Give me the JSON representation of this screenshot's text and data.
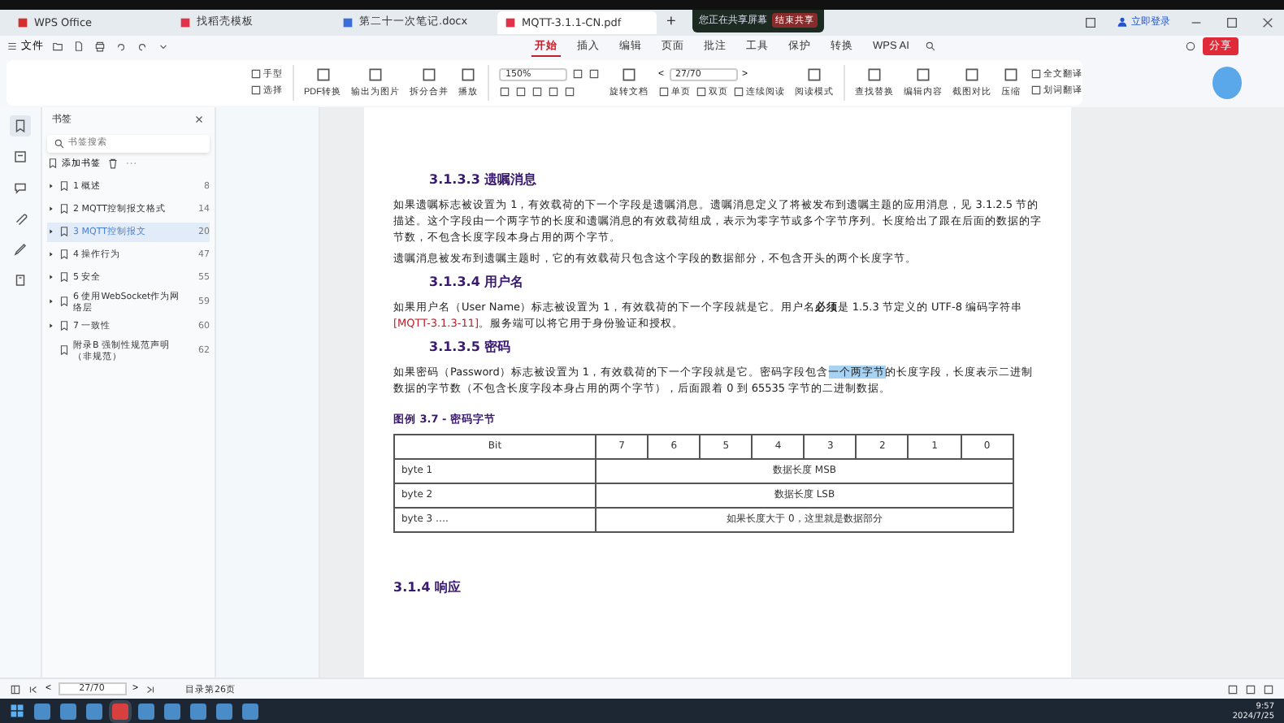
{
  "share_banner": {
    "text": "您正在共享屏幕",
    "button": "结束共享"
  },
  "tabs": [
    {
      "label": "WPS Office",
      "kind": "home",
      "selected": false
    },
    {
      "label": "找稻壳模板",
      "kind": "pdf",
      "selected": false
    },
    {
      "label": "第二十一次笔记.docx",
      "kind": "doc",
      "selected": false
    },
    {
      "label": "MQTT-3.1.1-CN.pdf",
      "kind": "pdf",
      "selected": true
    }
  ],
  "new_tab": "+",
  "account": {
    "label": "立即登录"
  },
  "menu": {
    "file": "文件",
    "items": [
      {
        "label": "开始",
        "selected": true
      },
      {
        "label": "插入",
        "selected": false
      },
      {
        "label": "编辑",
        "selected": false
      },
      {
        "label": "页面",
        "selected": false
      },
      {
        "label": "批注",
        "selected": false
      },
      {
        "label": "工具",
        "selected": false
      },
      {
        "label": "保护",
        "selected": false
      },
      {
        "label": "转换",
        "selected": false
      }
    ],
    "ai": "WPS AI",
    "share": "分享"
  },
  "toolbar": [
    [
      [
        {
          "kind": "small",
          "label": "手型"
        }
      ],
      [
        {
          "kind": "small",
          "label": "选择"
        }
      ]
    ],
    [
      [
        {
          "kind": "large",
          "label": "PDF转换"
        }
      ]
    ],
    [
      [
        {
          "kind": "large",
          "label": "输出为图片"
        }
      ]
    ],
    [
      [
        {
          "kind": "large",
          "label": "拆分合并"
        }
      ]
    ],
    [
      [
        {
          "kind": "large",
          "label": "播放"
        }
      ]
    ],
    [
      [
        {
          "kind": "field",
          "label": "150%"
        },
        {
          "kind": "icon"
        },
        {
          "kind": "icon"
        }
      ],
      [
        {
          "kind": "icon"
        },
        {
          "kind": "icon"
        },
        {
          "kind": "icon"
        },
        {
          "kind": "icon"
        },
        {
          "kind": "icon"
        }
      ]
    ],
    [
      [
        {
          "kind": "large",
          "label": "旋转文档"
        }
      ]
    ],
    [
      [
        {
          "kind": "nav",
          "label": "<"
        },
        {
          "kind": "field",
          "label": "27/70"
        },
        {
          "kind": "nav",
          "label": ">"
        }
      ],
      [
        {
          "kind": "small",
          "label": "单页"
        },
        {
          "kind": "small",
          "label": "双页"
        },
        {
          "kind": "small",
          "label": "连续阅读"
        }
      ]
    ],
    [
      [
        {
          "kind": "large",
          "label": "阅读模式"
        }
      ]
    ],
    [
      [
        {
          "kind": "large",
          "label": "查找替换"
        }
      ]
    ],
    [
      [
        {
          "kind": "large",
          "label": "编辑内容"
        }
      ]
    ],
    [
      [
        {
          "kind": "large",
          "label": "截图对比"
        }
      ]
    ],
    [
      [
        {
          "kind": "large",
          "label": "压缩"
        }
      ]
    ],
    [
      [
        {
          "kind": "small",
          "label": "全文翻译"
        }
      ],
      [
        {
          "kind": "small",
          "label": "划词翻译"
        }
      ]
    ]
  ],
  "side_icons": [
    {
      "selected": true
    },
    {
      "selected": false
    },
    {
      "selected": false
    },
    {
      "selected": false
    },
    {
      "selected": false
    },
    {
      "selected": false
    }
  ],
  "bookmarks": {
    "title": "书签",
    "search": {
      "placeholder": "书签搜索"
    },
    "add": "添加书签",
    "items": [
      {
        "label": "1 概述",
        "page": "8",
        "expandable": true,
        "selected": false
      },
      {
        "label": "2 MQTT控制报文格式",
        "page": "14",
        "expandable": true,
        "selected": false
      },
      {
        "label": "3 MQTT控制报文",
        "page": "20",
        "expandable": true,
        "selected": true
      },
      {
        "label": "4 操作行为",
        "page": "47",
        "expandable": true,
        "selected": false
      },
      {
        "label": "5 安全",
        "page": "55",
        "expandable": true,
        "selected": false
      },
      {
        "label": "6 使用WebSocket作为网络层",
        "page": "59",
        "expandable": true,
        "selected": false
      },
      {
        "label": "7 一致性",
        "page": "60",
        "expandable": true,
        "selected": false
      },
      {
        "label": "附录B 强制性规范声明（非规范）",
        "page": "62",
        "expandable": false,
        "selected": false
      }
    ]
  },
  "document": [
    {
      "kind": "heading",
      "text": "3.1.3.3 遗嘱消息"
    },
    {
      "kind": "para",
      "runs": [
        {
          "kind": "plain",
          "text": "如果遗嘱标志被设置为 1，有效载荷的下一个字段是遗嘱消息。遗嘱消息定义了将被发布到遗嘱主题的应用消息，见 3.1.2.5 节的描述。这个字段由一个两字节的长度和遗嘱消息的有效载荷组成，表示为零字节或多个字节序列。长度给出了跟在后面的数据的字节数，不包含长度字段本身占用的两个字节。"
        }
      ]
    },
    {
      "kind": "para",
      "runs": [
        {
          "kind": "plain",
          "text": "遗嘱消息被发布到遗嘱主题时，它的有效载荷只包含这个字段的数据部分，不包含开头的两个长度字节。"
        }
      ]
    },
    {
      "kind": "heading",
      "text": "3.1.3.4 用户名"
    },
    {
      "kind": "para",
      "runs": [
        {
          "kind": "plain",
          "text": "如果用户名（User Name）标志被设置为 1，有效载荷的下一个字段就是它。用户名"
        },
        {
          "kind": "bold",
          "text": "必须"
        },
        {
          "kind": "plain",
          "text": "是 1.5.3 节定义的 UTF-8 编码字符串 "
        },
        {
          "kind": "ref",
          "text": "[MQTT-3.1.3-11]"
        },
        {
          "kind": "plain",
          "text": "。服务端可以将它用于身份验证和授权。"
        }
      ]
    },
    {
      "kind": "heading",
      "text": "3.1.3.5 密码"
    },
    {
      "kind": "para",
      "runs": [
        {
          "kind": "plain",
          "text": "如果密码（Password）标志被设置为 1，有效载荷的下一个字段就是它。密码字段包含"
        },
        {
          "kind": "highlight",
          "text": "一个两字节"
        },
        {
          "kind": "plain",
          "text": "的长度字段，长度表示二进制数据的字节数（不包含长度字段本身占用的两个字节），后面跟着 0 到 65535 字节的二进制数据。"
        }
      ]
    },
    {
      "kind": "caption",
      "text": "图例 3.7 - 密码字节"
    },
    {
      "kind": "table",
      "header": [
        "Bit",
        "7",
        "6",
        "5",
        "4",
        "3",
        "2",
        "1",
        "0"
      ],
      "rows": [
        [
          "byte 1",
          "数据长度 MSB"
        ],
        [
          "byte 2",
          "数据长度 LSB"
        ],
        [
          "byte 3 ….",
          "如果长度大于 0，这里就是数据部分"
        ]
      ]
    },
    {
      "kind": "section",
      "text": "3.1.4 响应"
    }
  ],
  "status": {
    "page": "27/70",
    "prev": "<",
    "next": ">",
    "note": "目录第26页"
  },
  "taskbar": {
    "apps": [
      {
        "selected": false
      },
      {
        "selected": false
      },
      {
        "selected": false
      },
      {
        "selected": true
      },
      {
        "selected": false
      },
      {
        "selected": false
      },
      {
        "selected": false
      },
      {
        "selected": false
      },
      {
        "selected": false
      }
    ],
    "time": "9:57",
    "date": "2024/7/25"
  }
}
